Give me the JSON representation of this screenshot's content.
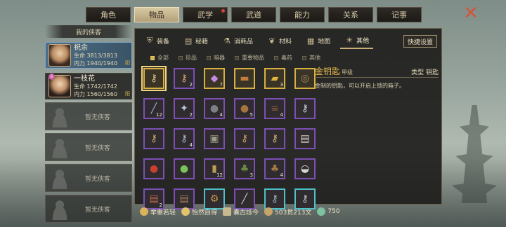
{
  "top_tabs": [
    {
      "label": "角色",
      "active": false,
      "dot": false
    },
    {
      "label": "物品",
      "active": true,
      "dot": false
    },
    {
      "label": "武学",
      "active": false,
      "dot": true
    },
    {
      "label": "武道",
      "active": false,
      "dot": false
    },
    {
      "label": "能力",
      "active": false,
      "dot": false
    },
    {
      "label": "关系",
      "active": false,
      "dot": false
    },
    {
      "label": "记事",
      "active": false,
      "dot": false
    }
  ],
  "left_panel": {
    "title": "我的侠客",
    "heroes": [
      {
        "name": "祝余",
        "hp": "生命 3813/3813",
        "mp": "内力 1940/1940",
        "tag": "阳",
        "selected": true,
        "badge": ""
      },
      {
        "name": "一枝花",
        "hp": "生命 1742/1742",
        "mp": "内力 1560/1560",
        "tag": "阳",
        "selected": false,
        "badge": "6"
      }
    ],
    "empty_label": "暂无侠客",
    "empty_count": 4
  },
  "categories": [
    {
      "label": "装备",
      "icon": "armor-icon",
      "active": false
    },
    {
      "label": "秘籍",
      "icon": "book-icon",
      "active": false
    },
    {
      "label": "消耗品",
      "icon": "flask-icon",
      "active": false
    },
    {
      "label": "材料",
      "icon": "leaf-icon",
      "active": false
    },
    {
      "label": "地图",
      "icon": "map-icon",
      "active": false
    },
    {
      "label": "其他",
      "icon": "lightbulb-icon",
      "active": true
    }
  ],
  "quick_settings": "快捷设置",
  "filters": [
    {
      "label": "全部",
      "on": true
    },
    {
      "label": "珍品",
      "on": false
    },
    {
      "label": "暗器",
      "on": false
    },
    {
      "label": "重要物品",
      "on": false
    },
    {
      "label": "毒药",
      "on": false
    },
    {
      "label": "其他",
      "on": false
    }
  ],
  "items": [
    {
      "glyph": "⚷",
      "count": "",
      "quality": "gold",
      "color": "#d9c08a",
      "selected": true
    },
    {
      "glyph": "⚷",
      "count": "2",
      "quality": "purple",
      "color": "#c9a46a",
      "selected": false
    },
    {
      "glyph": "◆",
      "count": "7",
      "quality": "gold",
      "color": "#c78ae0",
      "selected": false
    },
    {
      "glyph": "▬",
      "count": "",
      "quality": "gold",
      "color": "#c27b3a",
      "selected": false
    },
    {
      "glyph": "▰",
      "count": "3",
      "quality": "gold",
      "color": "#e0b73c",
      "selected": false
    },
    {
      "glyph": "◎",
      "count": "",
      "quality": "gold",
      "color": "#a68d5e",
      "selected": false
    },
    {
      "glyph": "╱",
      "count": "12",
      "quality": "purple",
      "color": "#9fb3d9",
      "selected": false
    },
    {
      "glyph": "✦",
      "count": "2",
      "quality": "purple",
      "color": "#b9c6d6",
      "selected": false
    },
    {
      "glyph": "●",
      "count": "4",
      "quality": "purple",
      "color": "#7c7f85",
      "selected": false
    },
    {
      "glyph": "●",
      "count": "5",
      "quality": "purple",
      "color": "#a5743e",
      "selected": false
    },
    {
      "glyph": "≡",
      "count": "4",
      "quality": "purple",
      "color": "#8c5b3b",
      "selected": false
    },
    {
      "glyph": "⚷",
      "count": "",
      "quality": "purple",
      "color": "#c6ccd4",
      "selected": false
    },
    {
      "glyph": "⚷",
      "count": "",
      "quality": "purple",
      "color": "#c9a46a",
      "selected": false
    },
    {
      "glyph": "⚷",
      "count": "4",
      "quality": "purple",
      "color": "#aab7c9",
      "selected": false
    },
    {
      "glyph": "▣",
      "count": "",
      "quality": "purple",
      "color": "#9a9a86",
      "selected": false
    },
    {
      "glyph": "⚷",
      "count": "",
      "quality": "purple",
      "color": "#c9a46a",
      "selected": false
    },
    {
      "glyph": "⚷",
      "count": "",
      "quality": "purple",
      "color": "#d4b27a",
      "selected": false
    },
    {
      "glyph": "▤",
      "count": "",
      "quality": "purple",
      "color": "#dcd6c6",
      "selected": false
    },
    {
      "glyph": "●",
      "count": "",
      "quality": "purple",
      "color": "#c9402f",
      "selected": false
    },
    {
      "glyph": "●",
      "count": "",
      "quality": "purple",
      "color": "#7cc15a",
      "selected": false
    },
    {
      "glyph": "▮",
      "count": "12",
      "quality": "purple",
      "color": "#b79b56",
      "selected": false
    },
    {
      "glyph": "♣",
      "count": "3",
      "quality": "purple",
      "color": "#6e8a4a",
      "selected": false
    },
    {
      "glyph": "♣",
      "count": "4",
      "quality": "purple",
      "color": "#a37844",
      "selected": false
    },
    {
      "glyph": "◒",
      "count": "",
      "quality": "purple",
      "color": "#d6d9cc",
      "selected": false
    },
    {
      "glyph": "▤",
      "count": "2",
      "quality": "purple",
      "color": "#c26a4a",
      "selected": false
    },
    {
      "glyph": "▤",
      "count": "",
      "quality": "purple",
      "color": "#a37a5a",
      "selected": false
    },
    {
      "glyph": "⚙",
      "count": "",
      "quality": "cyan",
      "color": "#c79a4b",
      "selected": false
    },
    {
      "glyph": "╱",
      "count": "",
      "quality": "purple",
      "color": "#c9c9c9",
      "selected": false
    },
    {
      "glyph": "⚷",
      "count": "",
      "quality": "cyan",
      "color": "#9cb3c4",
      "selected": false
    },
    {
      "glyph": "⚷",
      "count": "",
      "quality": "cyan",
      "color": "#b8c0c9",
      "selected": false
    }
  ],
  "detail": {
    "name": "金钥匙",
    "grade": "甲级",
    "type": "类型  钥匙",
    "description": "金制的钥匙，可以开启上锁的箱子。"
  },
  "bottom_bar": [
    {
      "icon": "weight-icon",
      "label": "举重若轻",
      "color": "#d9b45a"
    },
    {
      "icon": "smile-icon",
      "label": "怡然自得",
      "color": "#e0c36b"
    },
    {
      "icon": "book-icon",
      "label": "囊古烁今",
      "color": "#c9b98f"
    },
    {
      "icon": "coin-icon",
      "label": "503贯213文",
      "color": "#c9a46a"
    },
    {
      "icon": "jade-icon",
      "label": "750",
      "color": "#7cc1a0"
    }
  ]
}
